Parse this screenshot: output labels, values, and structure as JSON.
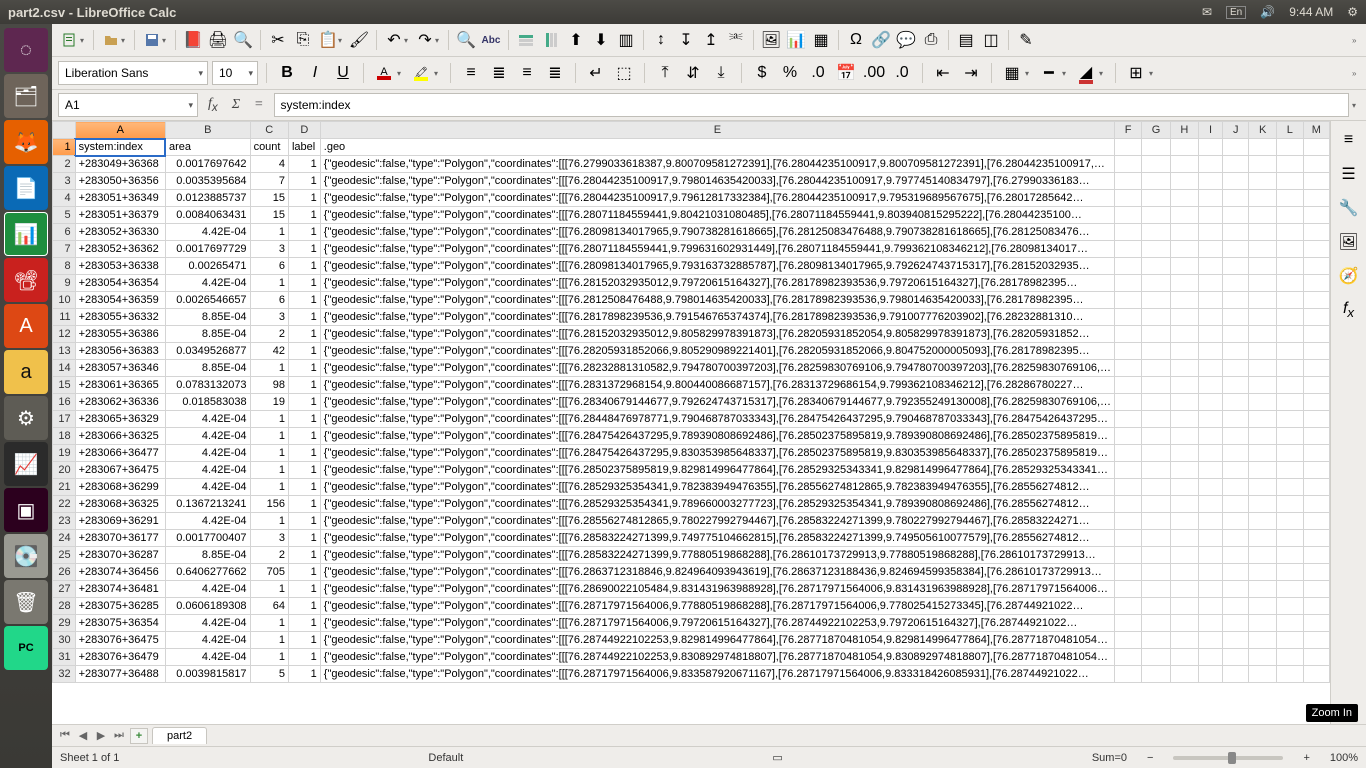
{
  "window": {
    "title": "part2.csv - LibreOffice Calc"
  },
  "tray": {
    "lang": "En",
    "time": "9:44 AM"
  },
  "format": {
    "font": "Liberation Sans",
    "size": "10"
  },
  "cellref": "A1",
  "formula": "system:index",
  "sheet_tab": "part2",
  "status": {
    "sheet": "Sheet 1 of 1",
    "style": "Default",
    "sum": "Sum=0",
    "zoom": "100%"
  },
  "tooltip": "Zoom In",
  "columns": [
    "A",
    "B",
    "C",
    "D",
    "E",
    "F",
    "G",
    "H",
    "I",
    "J",
    "K",
    "L",
    "M"
  ],
  "headers": {
    "A": "system:index",
    "B": "area",
    "C": "count",
    "D": "label",
    "E": ".geo"
  },
  "rows": [
    {
      "n": 2,
      "a": "+283049+36368",
      "b": "0.0017697642",
      "c": "4",
      "d": "1",
      "e": "{\"geodesic\":false,\"type\":\"Polygon\",\"coordinates\":[[[76.2799033618387,9.800709581272391],[76.28044235100917,9.800709581272391],[76.28044235100917,…"
    },
    {
      "n": 3,
      "a": "+283050+36356",
      "b": "0.0035395684",
      "c": "7",
      "d": "1",
      "e": "{\"geodesic\":false,\"type\":\"Polygon\",\"coordinates\":[[[76.28044235100917,9.798014635420033],[76.28044235100917,9.797745140834797],[76.27990336183…"
    },
    {
      "n": 4,
      "a": "+283051+36349",
      "b": "0.0123885737",
      "c": "15",
      "d": "1",
      "e": "{\"geodesic\":false,\"type\":\"Polygon\",\"coordinates\":[[[76.28044235100917,9.79612817332384],[76.28044235100917,9.795319689567675],[76.28017285642…"
    },
    {
      "n": 5,
      "a": "+283051+36379",
      "b": "0.0084063431",
      "c": "15",
      "d": "1",
      "e": "{\"geodesic\":false,\"type\":\"Polygon\",\"coordinates\":[[[76.28071184559441,9.80421031080485],[76.28071184559441,9.803940815295222],[76.28044235100…"
    },
    {
      "n": 6,
      "a": "+283052+36330",
      "b": "4.42E-04",
      "c": "1",
      "d": "1",
      "e": "{\"geodesic\":false,\"type\":\"Polygon\",\"coordinates\":[[[76.28098134017965,9.790738281618665],[76.28125083476488,9.790738281618665],[76.28125083476…"
    },
    {
      "n": 7,
      "a": "+283052+36362",
      "b": "0.0017697729",
      "c": "3",
      "d": "1",
      "e": "{\"geodesic\":false,\"type\":\"Polygon\",\"coordinates\":[[[76.28071184559441,9.799631602931449],[76.28071184559441,9.799362108346212],[76.28098134017…"
    },
    {
      "n": 8,
      "a": "+283053+36338",
      "b": "0.00265471",
      "c": "6",
      "d": "1",
      "e": "{\"geodesic\":false,\"type\":\"Polygon\",\"coordinates\":[[[76.28098134017965,9.793163732885787],[76.28098134017965,9.792624743715317],[76.28152032935…"
    },
    {
      "n": 9,
      "a": "+283054+36354",
      "b": "4.42E-04",
      "c": "1",
      "d": "1",
      "e": "{\"geodesic\":false,\"type\":\"Polygon\",\"coordinates\":[[[76.28152032935012,9.79720615164327],[76.28178982393536,9.79720615164327],[76.28178982395…"
    },
    {
      "n": 10,
      "a": "+283054+36359",
      "b": "0.0026546657",
      "c": "6",
      "d": "1",
      "e": "{\"geodesic\":false,\"type\":\"Polygon\",\"coordinates\":[[[76.2812508476488,9.798014635420033],[76.28178982393536,9.798014635420033],[76.28178982395…"
    },
    {
      "n": 11,
      "a": "+283055+36332",
      "b": "8.85E-04",
      "c": "3",
      "d": "1",
      "e": "{\"geodesic\":false,\"type\":\"Polygon\",\"coordinates\":[[[76.2817898239536,9.791546765374374],[76.28178982393536,9.791007776203902],[76.28232881310…"
    },
    {
      "n": 12,
      "a": "+283055+36386",
      "b": "8.85E-04",
      "c": "2",
      "d": "1",
      "e": "{\"geodesic\":false,\"type\":\"Polygon\",\"coordinates\":[[[76.28152032935012,9.805829978391873],[76.28205931852054,9.805829978391873],[76.28205931852…"
    },
    {
      "n": 13,
      "a": "+283056+36383",
      "b": "0.0349526877",
      "c": "42",
      "d": "1",
      "e": "{\"geodesic\":false,\"type\":\"Polygon\",\"coordinates\":[[[76.28205931852066,9.805290989221401],[76.28205931852066,9.804752000005093],[76.28178982395…"
    },
    {
      "n": 14,
      "a": "+283057+36346",
      "b": "8.85E-04",
      "c": "1",
      "d": "1",
      "e": "{\"geodesic\":false,\"type\":\"Polygon\",\"coordinates\":[[[76.28232881310582,9.794780700397203],[76.28259830769106,9.794780700397203],[76.28259830769106,…"
    },
    {
      "n": 15,
      "a": "+283061+36365",
      "b": "0.0783132073",
      "c": "98",
      "d": "1",
      "e": "{\"geodesic\":false,\"type\":\"Polygon\",\"coordinates\":[[[76.2831372968154,9.800440086687157],[76.28313729686154,9.799362108346212],[76.28286780227…"
    },
    {
      "n": 16,
      "a": "+283062+36336",
      "b": "0.018583038",
      "c": "19",
      "d": "1",
      "e": "{\"geodesic\":false,\"type\":\"Polygon\",\"coordinates\":[[[76.28340679144677,9.792624743715317],[76.28340679144677,9.792355249130008],[76.28259830769106,…"
    },
    {
      "n": 17,
      "a": "+283065+36329",
      "b": "4.42E-04",
      "c": "1",
      "d": "1",
      "e": "{\"geodesic\":false,\"type\":\"Polygon\",\"coordinates\":[[[76.28448476978771,9.790468787033343],[76.28475426437295,9.790468787033343],[76.28475426437295…"
    },
    {
      "n": 18,
      "a": "+283066+36325",
      "b": "4.42E-04",
      "c": "1",
      "d": "1",
      "e": "{\"geodesic\":false,\"type\":\"Polygon\",\"coordinates\":[[[76.28475426437295,9.789390808692486],[76.28502375895819,9.789390808692486],[76.28502375895819…"
    },
    {
      "n": 19,
      "a": "+283066+36477",
      "b": "4.42E-04",
      "c": "1",
      "d": "1",
      "e": "{\"geodesic\":false,\"type\":\"Polygon\",\"coordinates\":[[[76.28475426437295,9.830353985648337],[76.28502375895819,9.830353985648337],[76.28502375895819…"
    },
    {
      "n": 20,
      "a": "+283067+36475",
      "b": "4.42E-04",
      "c": "1",
      "d": "1",
      "e": "{\"geodesic\":false,\"type\":\"Polygon\",\"coordinates\":[[[76.28502375895819,9.829814996477864],[76.28529325343341,9.829814996477864],[76.28529325343341…"
    },
    {
      "n": 21,
      "a": "+283068+36299",
      "b": "4.42E-04",
      "c": "1",
      "d": "1",
      "e": "{\"geodesic\":false,\"type\":\"Polygon\",\"coordinates\":[[[76.28529325354341,9.782383949476355],[76.28556274812865,9.782383949476355],[76.28556274812…"
    },
    {
      "n": 22,
      "a": "+283068+36325",
      "b": "0.1367213241",
      "c": "156",
      "d": "1",
      "e": "{\"geodesic\":false,\"type\":\"Polygon\",\"coordinates\":[[[76.28529325354341,9.789660003277723],[76.28529325354341,9.789390808692486],[76.28556274812…"
    },
    {
      "n": 23,
      "a": "+283069+36291",
      "b": "4.42E-04",
      "c": "1",
      "d": "1",
      "e": "{\"geodesic\":false,\"type\":\"Polygon\",\"coordinates\":[[[76.28556274812865,9.780227992794467],[76.28583224271399,9.780227992794467],[76.28583224271…"
    },
    {
      "n": 24,
      "a": "+283070+36177",
      "b": "0.0017700407",
      "c": "3",
      "d": "1",
      "e": "{\"geodesic\":false,\"type\":\"Polygon\",\"coordinates\":[[[76.28583224271399,9.749775104662815],[76.28583224271399,9.749505610077579],[76.28556274812…"
    },
    {
      "n": 25,
      "a": "+283070+36287",
      "b": "8.85E-04",
      "c": "2",
      "d": "1",
      "e": "{\"geodesic\":false,\"type\":\"Polygon\",\"coordinates\":[[[76.28583224271399,9.77880519868288],[76.28610173729913,9.77880519868288],[76.28610173729913…"
    },
    {
      "n": 26,
      "a": "+283074+36456",
      "b": "0.6406277662",
      "c": "705",
      "d": "1",
      "e": "{\"geodesic\":false,\"type\":\"Polygon\",\"coordinates\":[[[76.2863712318846,9.824964093943619],[76.28637123188436,9.824694599358384],[76.28610173729913…"
    },
    {
      "n": 27,
      "a": "+283074+36481",
      "b": "4.42E-04",
      "c": "1",
      "d": "1",
      "e": "{\"geodesic\":false,\"type\":\"Polygon\",\"coordinates\":[[[76.28690022105484,9.831431963988928],[76.28717971564006,9.831431963988928],[76.28717971564006…"
    },
    {
      "n": 28,
      "a": "+283075+36285",
      "b": "0.0606189308",
      "c": "64",
      "d": "1",
      "e": "{\"geodesic\":false,\"type\":\"Polygon\",\"coordinates\":[[[76.28717971564006,9.77880519868288],[76.28717971564006,9.778025415273345],[76.28744921022…"
    },
    {
      "n": 29,
      "a": "+283075+36354",
      "b": "4.42E-04",
      "c": "1",
      "d": "1",
      "e": "{\"geodesic\":false,\"type\":\"Polygon\",\"coordinates\":[[[76.28717971564006,9.79720615164327],[76.28744922102253,9.79720615164327],[76.28744921022…"
    },
    {
      "n": 30,
      "a": "+283076+36475",
      "b": "4.42E-04",
      "c": "1",
      "d": "1",
      "e": "{\"geodesic\":false,\"type\":\"Polygon\",\"coordinates\":[[[76.28744922102253,9.829814996477864],[76.28771870481054,9.829814996477864],[76.28771870481054…"
    },
    {
      "n": 31,
      "a": "+283076+36479",
      "b": "4.42E-04",
      "c": "1",
      "d": "1",
      "e": "{\"geodesic\":false,\"type\":\"Polygon\",\"coordinates\":[[[76.28744922102253,9.830892974818807],[76.28771870481054,9.830892974818807],[76.28771870481054…"
    },
    {
      "n": 32,
      "a": "+283077+36488",
      "b": "0.0039815817",
      "c": "5",
      "d": "1",
      "e": "{\"geodesic\":false,\"type\":\"Polygon\",\"coordinates\":[[[76.28717971564006,9.833587920671167],[76.28717971564006,9.833318426085931],[76.28744921022…"
    }
  ]
}
